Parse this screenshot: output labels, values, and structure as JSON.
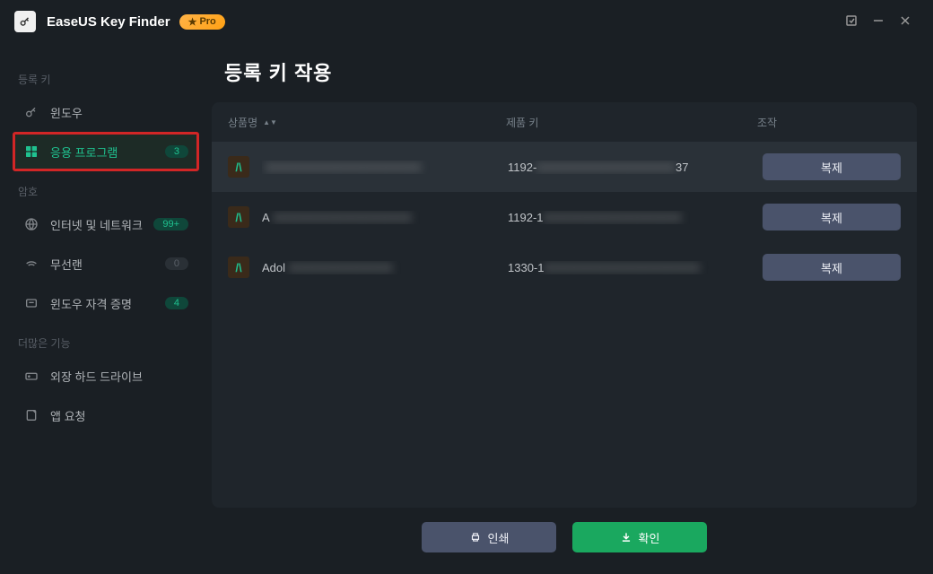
{
  "app": {
    "title": "EaseUS Key Finder",
    "pro_badge": "Pro"
  },
  "sidebar": {
    "section_key": "등록 키",
    "section_pw": "암호",
    "section_more": "더많은 기능",
    "items": {
      "windows": {
        "label": "윈도우"
      },
      "applications": {
        "label": "응용 프로그램",
        "badge": "3"
      },
      "internet": {
        "label": "인터넷 및 네트워크",
        "badge": "99+"
      },
      "wlan": {
        "label": "무선랜",
        "badge": "0"
      },
      "credentials": {
        "label": "윈도우 자격 증명",
        "badge": "4"
      },
      "external": {
        "label": "외장 하드 드라이브"
      },
      "summary": {
        "label": "앱 요청"
      }
    }
  },
  "page": {
    "title": "등록 키 작용"
  },
  "table": {
    "headers": {
      "name": "상품명",
      "key": "제품 키",
      "ops": "조작"
    },
    "copy_label": "복제",
    "rows": [
      {
        "name_prefix": "",
        "name_hidden": "XXXXXXXXXXXXXXXXXX",
        "key_prefix": "1192-",
        "key_suffix": "37",
        "key_hidden": "XXXXXXXXXXXXXXXX"
      },
      {
        "name_prefix": "A",
        "name_hidden": "XXXXXXXXXXXXXXXX",
        "key_prefix": "1192-1",
        "key_suffix": "",
        "key_hidden": "XXXXXXXXXXXXXXXX"
      },
      {
        "name_prefix": "Adol",
        "name_hidden": "XXXXXXXXXXXX",
        "key_prefix": "1330-1",
        "key_suffix": "",
        "key_hidden": "XXXXXXXXXXXXXXXXXX"
      }
    ]
  },
  "footer": {
    "print": "인쇄",
    "scan": "확인"
  }
}
